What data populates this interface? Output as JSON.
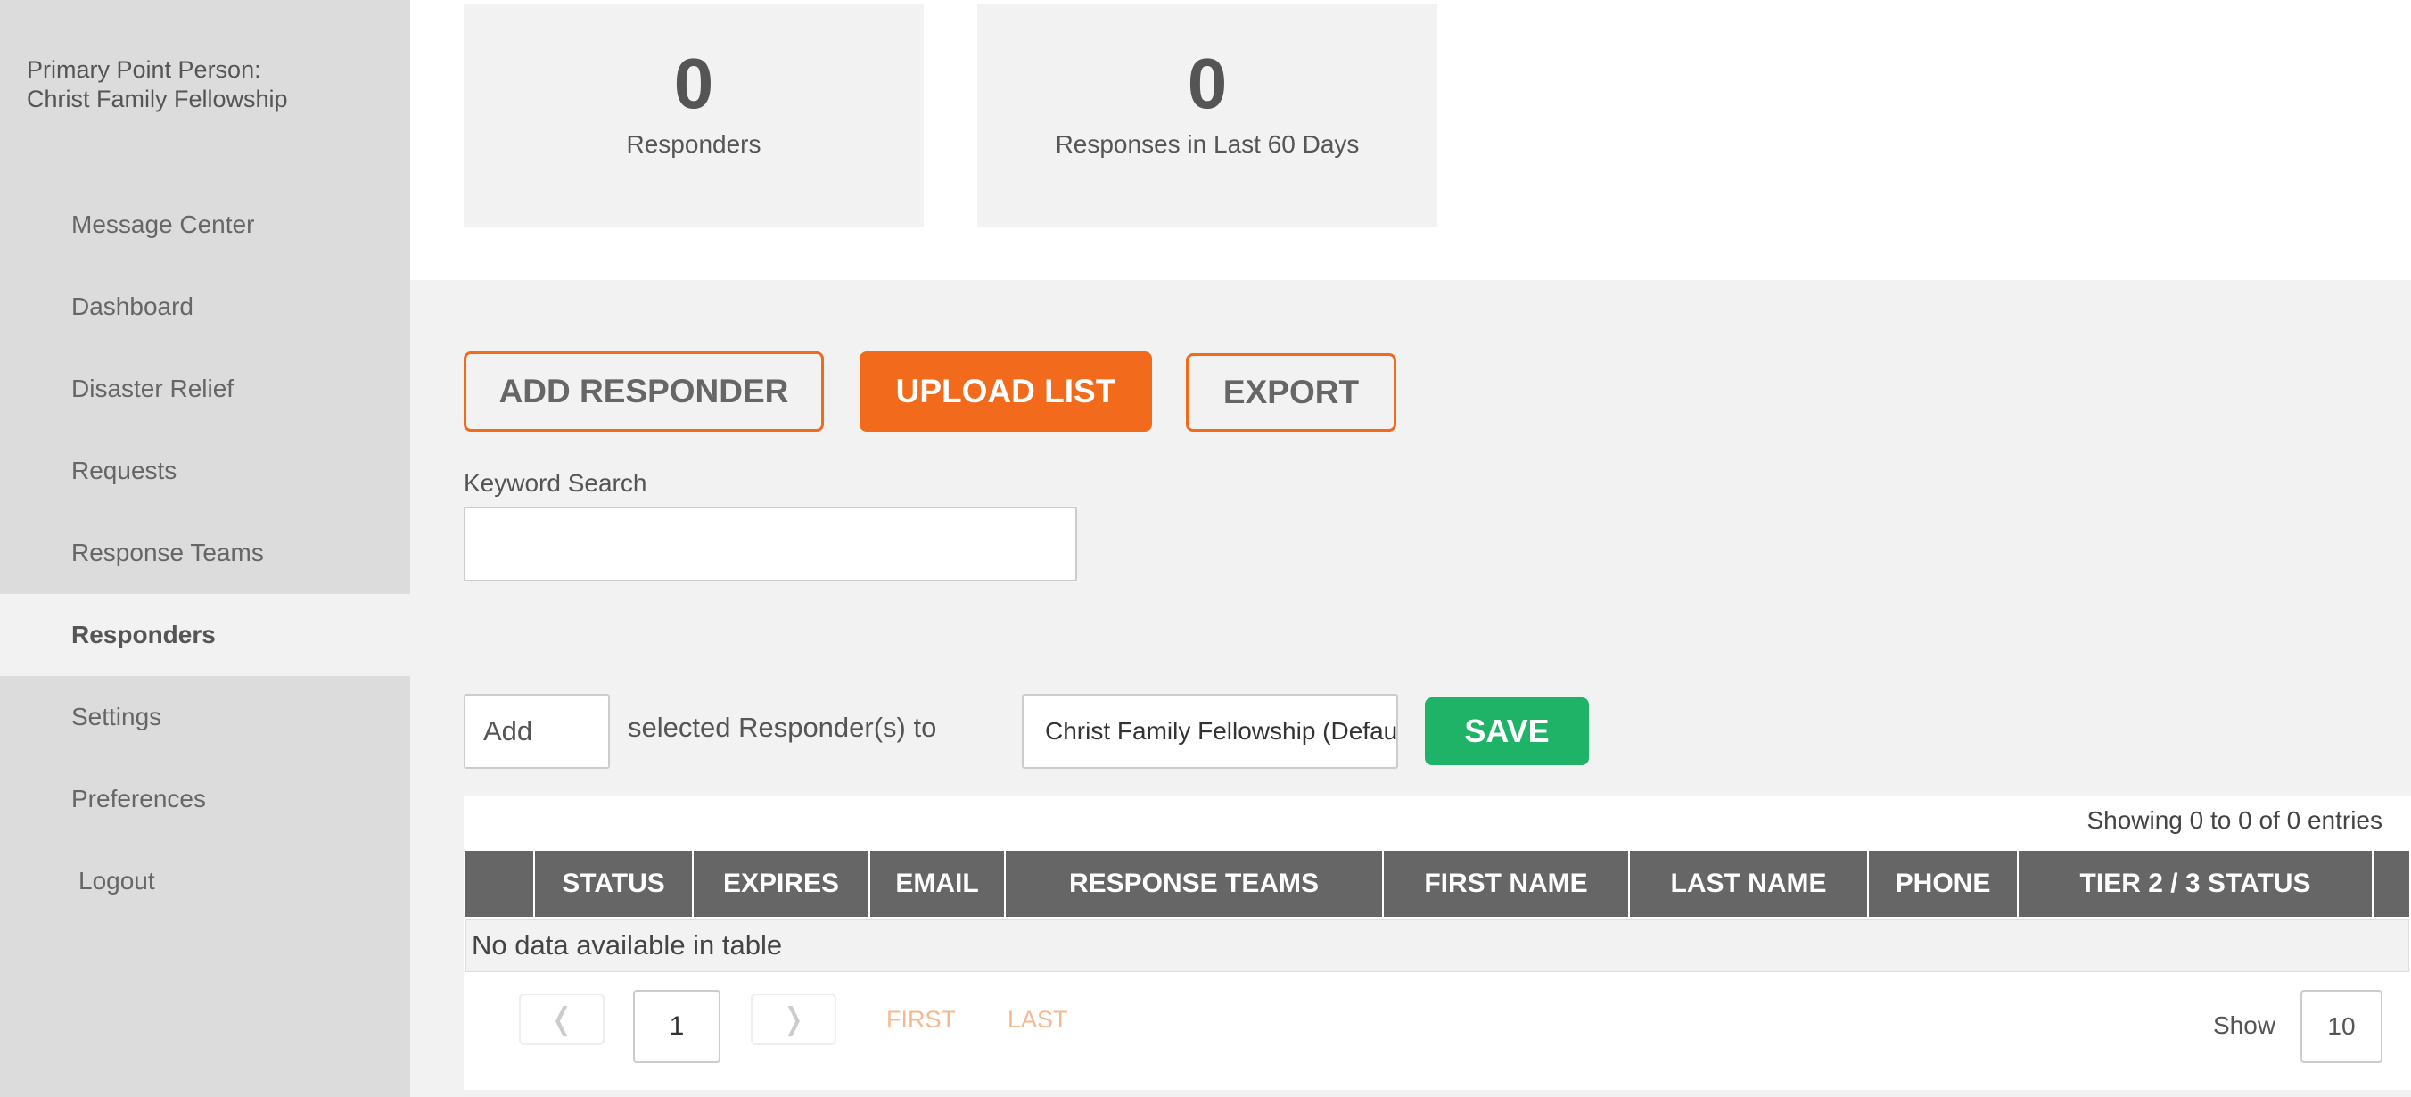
{
  "sidebar": {
    "point_person_label": "Primary Point Person:",
    "point_person_name": "Christ Family Fellowship",
    "items": [
      {
        "label": "Message Center"
      },
      {
        "label": "Dashboard"
      },
      {
        "label": "Disaster Relief"
      },
      {
        "label": "Requests"
      },
      {
        "label": "Response Teams"
      },
      {
        "label": "Responders"
      },
      {
        "label": "Settings"
      },
      {
        "label": "Preferences"
      },
      {
        "label": "Logout"
      }
    ],
    "active": "Responders"
  },
  "stats": [
    {
      "value": "0",
      "label": "Responders"
    },
    {
      "value": "0",
      "label": "Responses in Last 60 Days"
    }
  ],
  "actions": {
    "add_responder": "ADD RESPONDER",
    "upload_list": "UPLOAD LIST",
    "export": "EXPORT"
  },
  "search": {
    "label": "Keyword Search",
    "value": ""
  },
  "bulk": {
    "action_value": "Add",
    "middle_text": "selected Responder(s) to",
    "team_value": "Christ Family Fellowship (Default)",
    "save_label": "SAVE"
  },
  "table": {
    "showing": "Showing 0 to 0 of 0 entries",
    "columns": [
      "",
      "STATUS",
      "EXPIRES",
      "EMAIL",
      "RESPONSE TEAMS",
      "FIRST NAME",
      "LAST NAME",
      "PHONE",
      "TIER 2 / 3 STATUS",
      ""
    ],
    "empty_message": "No data available in table"
  },
  "pagination": {
    "prev": "❬",
    "next": "❭",
    "current_page": "1",
    "first": "FIRST",
    "last": "LAST",
    "show_label": "Show",
    "page_size": "10"
  },
  "colors": {
    "accent": "#f26a1b",
    "save": "#1eb366",
    "header": "#666666"
  }
}
